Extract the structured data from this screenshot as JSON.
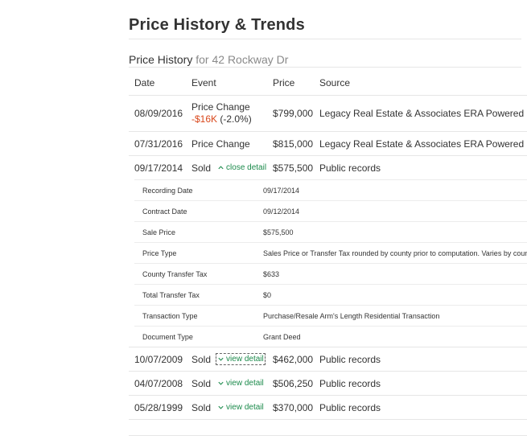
{
  "section_title": "Price History & Trends",
  "subtitle": {
    "label": "Price History",
    "address": "for 42 Rockway Dr"
  },
  "columns": {
    "date": "Date",
    "event": "Event",
    "price": "Price",
    "source": "Source"
  },
  "rows": [
    {
      "date": "08/09/2016",
      "event": "Price Change",
      "change_amount": "-$16K",
      "change_pct": "(-2.0%)",
      "price": "$799,000",
      "source": "Legacy Real Estate & Associates ERA Powered"
    },
    {
      "date": "07/31/2016",
      "event": "Price Change",
      "price": "$815,000",
      "source": "Legacy Real Estate & Associates ERA Powered"
    },
    {
      "date": "09/17/2014",
      "event": "Sold",
      "link": "close detail",
      "price": "$575,500",
      "source": "Public records"
    },
    {
      "date": "10/07/2009",
      "event": "Sold",
      "link": "view detail",
      "price": "$462,000",
      "source": "Public records"
    },
    {
      "date": "04/07/2008",
      "event": "Sold",
      "link": "view detail",
      "price": "$506,250",
      "source": "Public records"
    },
    {
      "date": "05/28/1999",
      "event": "Sold",
      "link": "view detail",
      "price": "$370,000",
      "source": "Public records"
    }
  ],
  "detail": [
    {
      "label": "Recording Date",
      "value": "09/17/2014"
    },
    {
      "label": "Contract Date",
      "value": "09/12/2014"
    },
    {
      "label": "Sale Price",
      "value": "$575,500"
    },
    {
      "label": "Price Type",
      "value": "Sales Price or Transfer Tax rounded by county prior to computation. Varies by county"
    },
    {
      "label": "County Transfer Tax",
      "value": "$633"
    },
    {
      "label": "Total Transfer Tax",
      "value": "$0"
    },
    {
      "label": "Transaction Type",
      "value": "Purchase/Resale Arm's Length Residential Transaction"
    },
    {
      "label": "Document Type",
      "value": "Grant Deed"
    }
  ],
  "colors": {
    "link": "#1b8a4b",
    "negative": "#d9481c",
    "text": "#333333",
    "muted": "#8a8a8a"
  },
  "icons": {
    "close": "chevron-up-icon",
    "view": "chevron-down-icon"
  }
}
